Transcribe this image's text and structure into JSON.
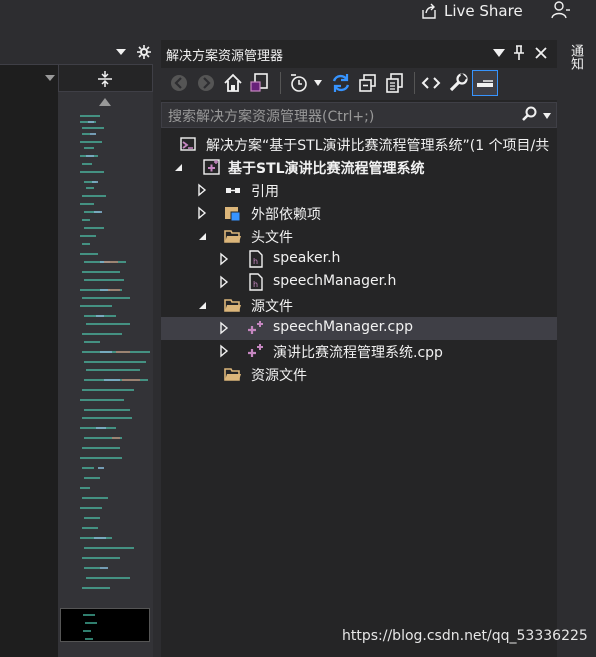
{
  "top": {
    "live_share": "Live Share"
  },
  "solution_explorer": {
    "title": "解决方案资源管理器",
    "search_placeholder": "搜索解决方案资源管理器(Ctrl+;)",
    "tree": [
      {
        "label": "解决方案“基于STL演讲比赛流程管理系统”(1 个项目/共",
        "bold": false
      },
      {
        "label": "基于STL演讲比赛流程管理系统",
        "bold": true
      },
      {
        "label": "引用"
      },
      {
        "label": "外部依赖项"
      },
      {
        "label": "头文件"
      },
      {
        "label": "speaker.h"
      },
      {
        "label": "speechManager.h"
      },
      {
        "label": "源文件"
      },
      {
        "label": "speechManager.cpp",
        "selected": true
      },
      {
        "label": "演讲比赛流程管理系统.cpp"
      },
      {
        "label": "资源文件"
      }
    ]
  },
  "notifications": {
    "label": "通知"
  },
  "watermark": "https://blog.csdn.net/qq_53336225",
  "colors": {
    "accent": "#007acc",
    "cpp_icon": "#c586c0",
    "folder": "#dcb67a",
    "background": "#252526"
  }
}
